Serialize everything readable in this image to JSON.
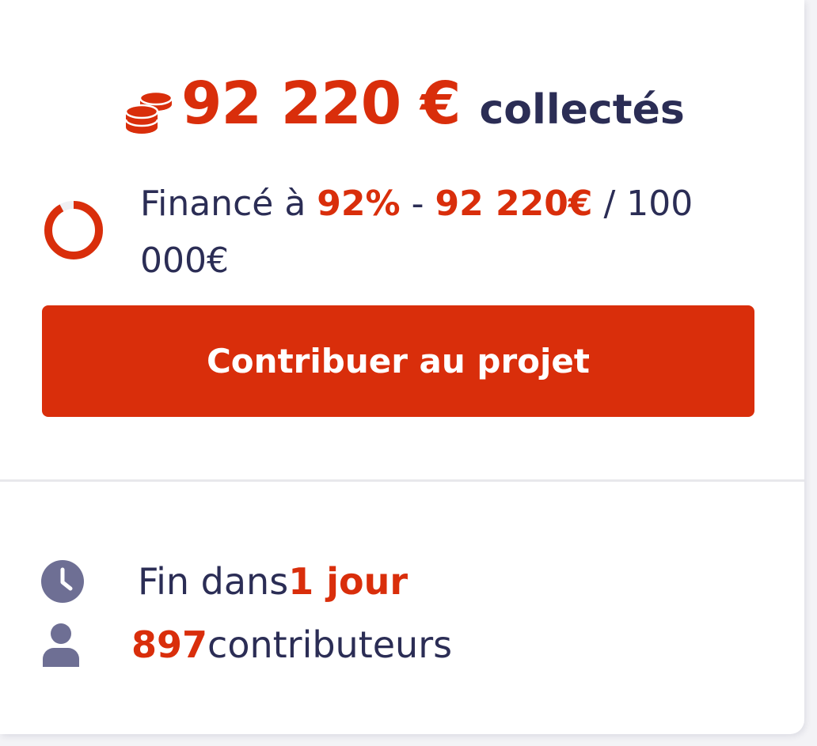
{
  "colors": {
    "accent": "#d92e0b",
    "text_dark": "#2b2d55",
    "icon_muted": "#6e6f94",
    "divider": "#e8e8ec"
  },
  "raised": {
    "icon": "coins-icon",
    "amount": "92 220 €",
    "suffix": "collectés"
  },
  "funding": {
    "progress_percent": 92,
    "prefix": "Financé à ",
    "percent_label": "92%",
    "separator": " - ",
    "collected": "92 220€",
    "goal": " / 100 000€"
  },
  "cta": {
    "label": "Contribuer au projet"
  },
  "deadline": {
    "icon": "clock-icon",
    "prefix": "Fin dans ",
    "value": "1 jour"
  },
  "backers": {
    "icon": "user-icon",
    "count": "897",
    "label": " contributeurs"
  }
}
